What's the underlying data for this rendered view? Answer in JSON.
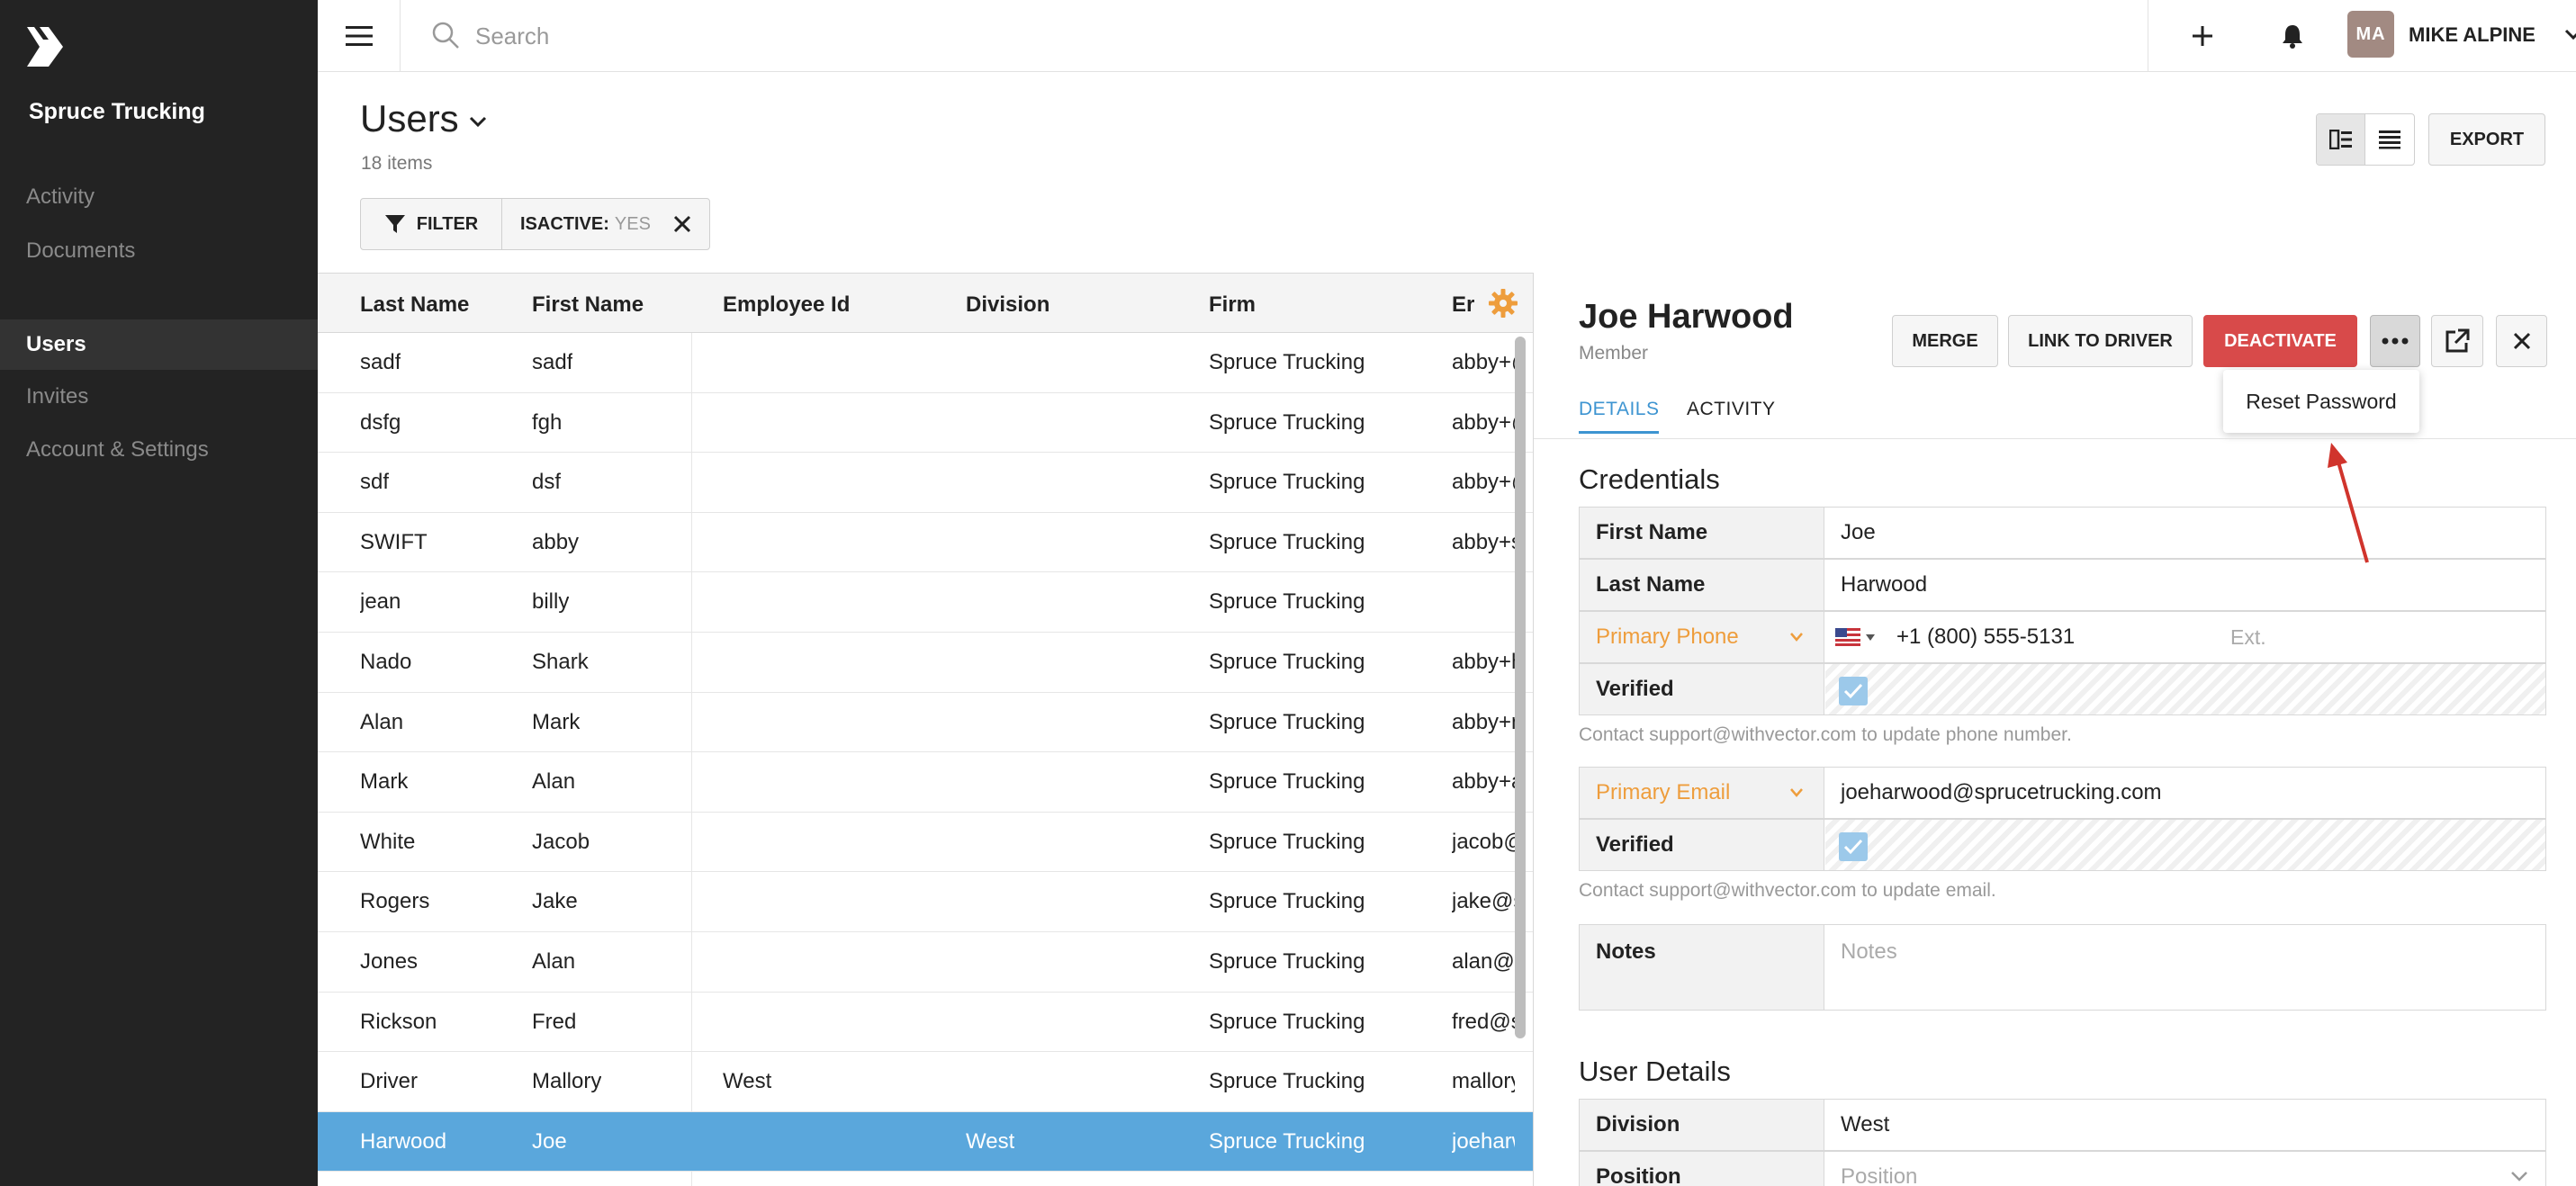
{
  "sidebar": {
    "org_name": "Spruce Trucking",
    "items": [
      {
        "label": "Activity"
      },
      {
        "label": "Documents"
      },
      {
        "label": "Users"
      },
      {
        "label": "Invites"
      },
      {
        "label": "Account & Settings"
      }
    ]
  },
  "topbar": {
    "search_placeholder": "Search",
    "avatar_initials": "MA",
    "user_name": "MIKE ALPINE"
  },
  "list": {
    "title": "Users",
    "count": "18 items",
    "filter_label": "FILTER",
    "chip_key": "ISACTIVE:",
    "chip_value": "YES",
    "export_label": "EXPORT",
    "columns": [
      "Last Name",
      "First Name",
      "Employee Id",
      "Division",
      "Firm",
      "Er"
    ],
    "rows": [
      {
        "last": "sadf",
        "first": "sadf",
        "emp": "",
        "div": "",
        "firm": "Spruce Trucking",
        "email": "abby+@"
      },
      {
        "last": "dsfg",
        "first": "fgh",
        "emp": "",
        "div": "",
        "firm": "Spruce Trucking",
        "email": "abby+@"
      },
      {
        "last": "sdf",
        "first": "dsf",
        "emp": "",
        "div": "",
        "firm": "Spruce Trucking",
        "email": "abby+@"
      },
      {
        "last": "SWIFT",
        "first": "abby",
        "emp": "",
        "div": "",
        "firm": "Spruce Trucking",
        "email": "abby+s"
      },
      {
        "last": "jean",
        "first": "billy",
        "emp": "",
        "div": "",
        "firm": "Spruce Trucking",
        "email": ""
      },
      {
        "last": "Nado",
        "first": "Shark",
        "emp": "",
        "div": "",
        "firm": "Spruce Trucking",
        "email": "abby+h"
      },
      {
        "last": "Alan",
        "first": "Mark",
        "emp": "",
        "div": "",
        "firm": "Spruce Trucking",
        "email": "abby+n"
      },
      {
        "last": "Mark",
        "first": "Alan",
        "emp": "",
        "div": "",
        "firm": "Spruce Trucking",
        "email": "abby+a"
      },
      {
        "last": "White",
        "first": "Jacob",
        "emp": "",
        "div": "",
        "firm": "Spruce Trucking",
        "email": "jacob@s"
      },
      {
        "last": "Rogers",
        "first": "Jake",
        "emp": "",
        "div": "",
        "firm": "Spruce Trucking",
        "email": "jake@sp"
      },
      {
        "last": "Jones",
        "first": "Alan",
        "emp": "",
        "div": "",
        "firm": "Spruce Trucking",
        "email": "alan@s"
      },
      {
        "last": "Rickson",
        "first": "Fred",
        "emp": "",
        "div": "",
        "firm": "Spruce Trucking",
        "email": "fred@s"
      },
      {
        "last": "Driver",
        "first": "Mallory",
        "emp": "West",
        "div": "",
        "firm": "Spruce Trucking",
        "email": "mallory@"
      },
      {
        "last": "Harwood",
        "first": "Joe",
        "emp": "",
        "div": "West",
        "firm": "Spruce Trucking",
        "email": "joeharwo"
      }
    ],
    "selected_row": 13
  },
  "detail": {
    "name": "Joe Harwood",
    "role": "Member",
    "buttons": {
      "merge": "MERGE",
      "link": "LINK TO DRIVER",
      "deactivate": "DEACTIVATE"
    },
    "menu_item": "Reset Password",
    "tabs": [
      "DETAILS",
      "ACTIVITY"
    ],
    "credentials_title": "Credentials",
    "first_name_label": "First Name",
    "first_name": "Joe",
    "last_name_label": "Last Name",
    "last_name": "Harwood",
    "phone_label": "Primary Phone",
    "phone": "+1 (800) 555-5131",
    "ext_placeholder": "Ext.",
    "verified_label": "Verified",
    "phone_hint": "Contact support@withvector.com to update phone number.",
    "email_label": "Primary Email",
    "email": "joeharwood@sprucetrucking.com",
    "email_hint": "Contact support@withvector.com to update email.",
    "notes_label": "Notes",
    "notes_placeholder": "Notes",
    "user_details_title": "User Details",
    "division_label": "Division",
    "division": "West",
    "position_label": "Position",
    "position_placeholder": "Position"
  },
  "colors": {
    "sidebar_bg": "#232323",
    "selected_row": "#5aa7dc",
    "danger": "#d84a4a",
    "accent_orange": "#ee9d3c",
    "tab_active": "#3d94d1",
    "annotation_arrow": "#d0342c"
  }
}
